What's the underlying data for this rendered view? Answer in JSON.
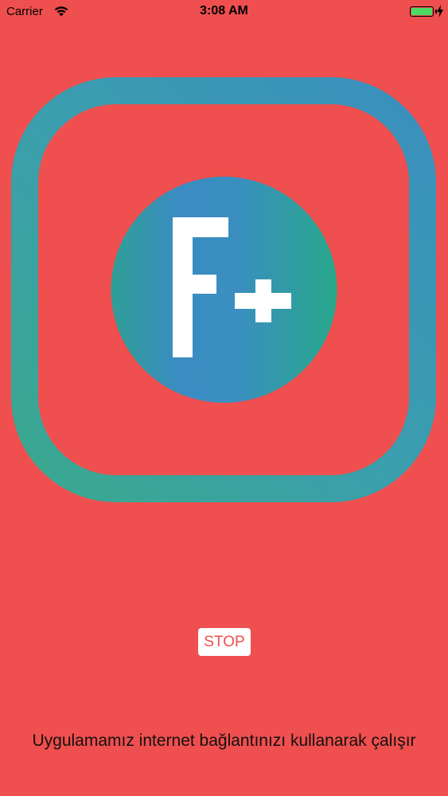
{
  "status_bar": {
    "carrier": "Carrier",
    "time": "3:08 AM",
    "wifi_icon": "wifi-icon",
    "battery_icon": "battery-icon",
    "battery_level": 1.0,
    "battery_color": "#4cd964",
    "charging_icon": "charging-bolt-icon"
  },
  "logo": {
    "text_f": "F",
    "text_plus": "+",
    "icon": "app-logo-icon"
  },
  "colors": {
    "background": "#ef4f4e",
    "button_background": "#ffffff",
    "button_text": "#ef4f4e",
    "teal": "#3aa59a",
    "blue": "#3a8ebd"
  },
  "stop_button": {
    "label": "STOP"
  },
  "footer": {
    "message": "Uygulamamız internet bağlantınızı kullanarak çalışır"
  }
}
